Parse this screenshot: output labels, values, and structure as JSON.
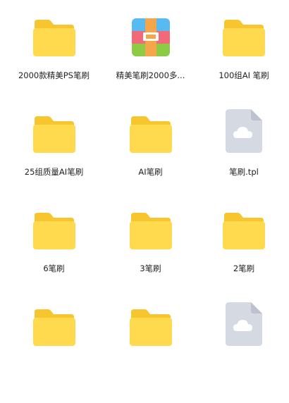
{
  "colors": {
    "folder_back": "#F7C52E",
    "folder_front": "#FFDA4F",
    "file_body": "#D5D9E2",
    "file_fold": "#BCC2CE",
    "cloud": "#FFFFFF",
    "archive_top": "#57BBF2",
    "archive_mid": "#F2697A",
    "archive_bottom": "#8DCB45",
    "archive_band": "#F5A54A"
  },
  "items": [
    {
      "type": "folder",
      "icon": "folder-icon",
      "label": "2000款精美PS笔刷"
    },
    {
      "type": "archive",
      "icon": "archive-icon",
      "label": "精美笔刷2000多..."
    },
    {
      "type": "folder",
      "icon": "folder-icon",
      "label": "100组AI 笔刷"
    },
    {
      "type": "folder",
      "icon": "folder-icon",
      "label": "25组质量AI笔刷"
    },
    {
      "type": "folder",
      "icon": "folder-icon",
      "label": "AI笔刷"
    },
    {
      "type": "file",
      "icon": "cloud-file-icon",
      "label": "笔刷.tpl"
    },
    {
      "type": "folder",
      "icon": "folder-icon",
      "label": "6笔刷"
    },
    {
      "type": "folder",
      "icon": "folder-icon",
      "label": "3笔刷"
    },
    {
      "type": "folder",
      "icon": "folder-icon",
      "label": "2笔刷"
    },
    {
      "type": "folder",
      "icon": "folder-icon",
      "label": ""
    },
    {
      "type": "folder",
      "icon": "folder-icon",
      "label": ""
    },
    {
      "type": "file",
      "icon": "cloud-file-icon",
      "label": ""
    }
  ]
}
